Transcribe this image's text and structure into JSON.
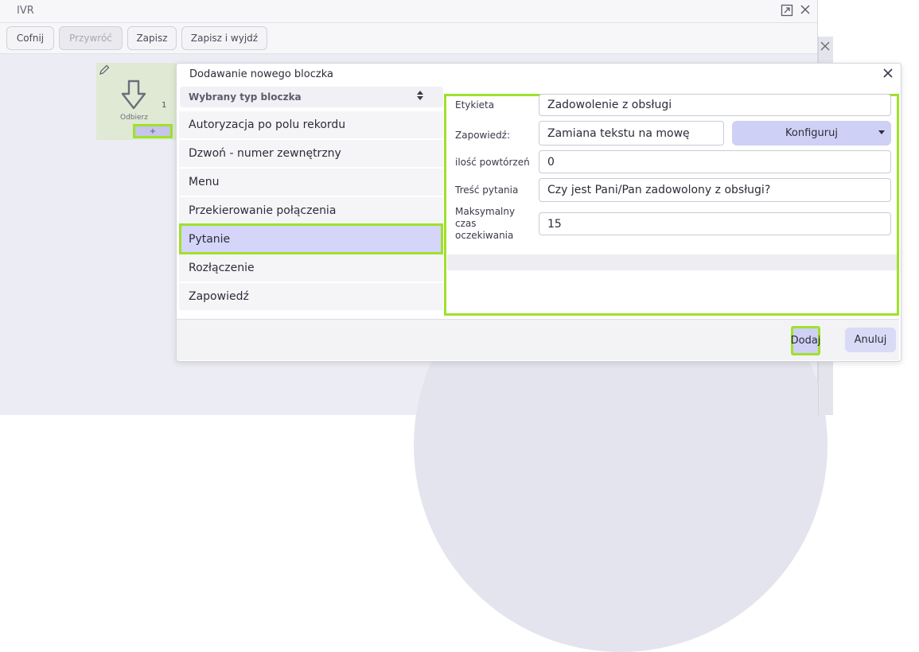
{
  "window": {
    "title": "IVR",
    "expand_icon": "expand-icon",
    "close_icon": "close-icon"
  },
  "toolbar": {
    "undo_label": "Cofnij",
    "redo_label": "Przywróć",
    "save_label": "Zapisz",
    "save_exit_label": "Zapisz i wyjdź"
  },
  "node": {
    "label": "Odbierz",
    "count": "1",
    "add_label": "+",
    "icon": "pick-up-arrow-icon",
    "edit_icon": "pencil-icon"
  },
  "dialog": {
    "title": "Dodawanie nowego bloczka",
    "type_header": "Wybrany typ bloczka",
    "types": [
      {
        "label": "Autoryzacja po polu rekordu"
      },
      {
        "label": "Dzwoń - numer zewnętrzny"
      },
      {
        "label": "Menu"
      },
      {
        "label": "Przekierowanie połączenia"
      },
      {
        "label": "Pytanie",
        "selected": true
      },
      {
        "label": "Rozłączenie"
      },
      {
        "label": "Zapowiedź"
      }
    ],
    "form": {
      "label_field": {
        "label": "Etykieta",
        "value": "Zadowolenie z obsługi"
      },
      "announcement": {
        "label": "Zapowiedź:",
        "value": "Zamiana tekstu na mowę",
        "configure_label": "Konfiguruj"
      },
      "repeat_count": {
        "label": "ilość powtórzeń",
        "value": "0"
      },
      "question": {
        "label": "Treść pytania",
        "value": "Czy jest Pani/Pan zadowolony z obsługi?"
      },
      "max_wait": {
        "label_line1": "Maksymalny",
        "label_line2": "czas",
        "label_line3": "oczekiwania",
        "value": "15"
      }
    },
    "add_label": "Dodaj",
    "cancel_label": "Anuluj"
  },
  "colors": {
    "highlight": "#9fe12a",
    "accent": "#cfd0f5",
    "selected": "#d4d5f8",
    "node_bg": "#dfe9d4"
  }
}
